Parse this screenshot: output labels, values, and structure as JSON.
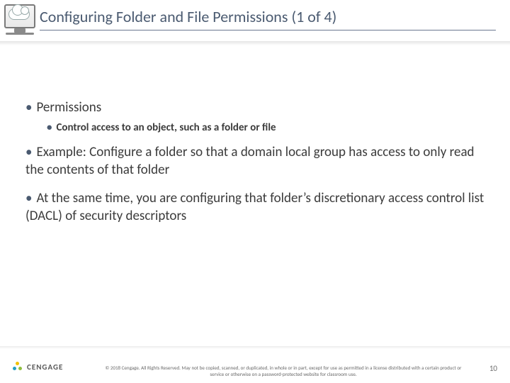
{
  "title": "Configuring Folder and File Permissions (1 of 4)",
  "bullets": {
    "perm_heading": "Permissions",
    "perm_sub": "Control access to an object, such as a folder or file",
    "example": "Example: Configure a folder so that a domain local group has access to only read the contents of that folder",
    "dacl": "At the same time, you are configuring that folder’s discretionary access control list (DACL) of security descriptors"
  },
  "footer": {
    "brand": "CENGAGE",
    "copyright": "© 2018 Cengage. All Rights Reserved. May not be copied, scanned, or duplicated, in whole or in part, except for use as permitted in a license distributed with a certain product or service or otherwise on a password-protected website for classroom use.",
    "page": "10"
  }
}
